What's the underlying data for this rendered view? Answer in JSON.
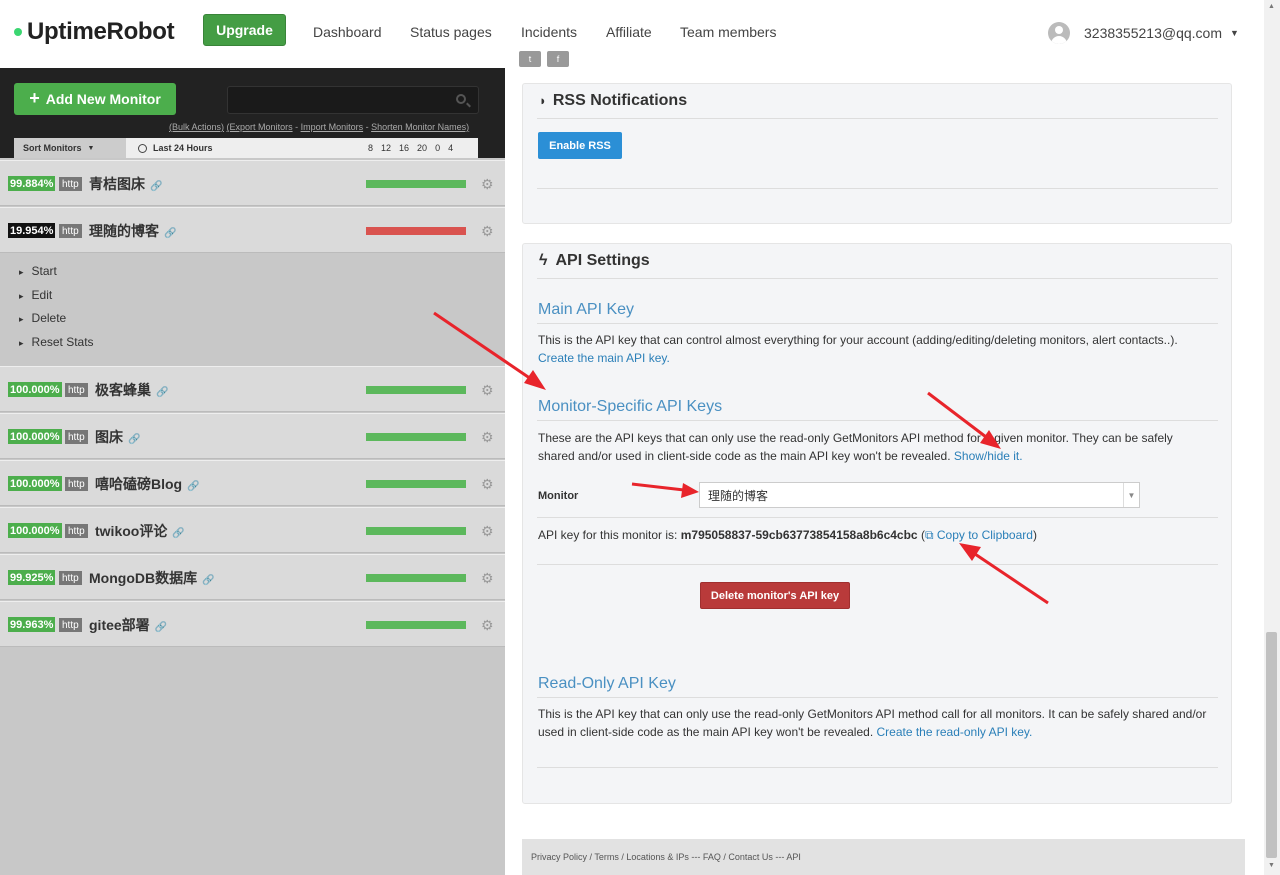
{
  "brand": {
    "name": "UptimeRobot"
  },
  "header": {
    "upgrade_label": "Upgrade",
    "nav": [
      "Dashboard",
      "Status pages",
      "Incidents",
      "Affiliate",
      "Team members"
    ],
    "user_email": "3238355213@qq.com"
  },
  "sidebar": {
    "add_monitor_label": "Add New Monitor",
    "search_placeholder": "",
    "bulk_links": [
      "(Bulk Actions)",
      "(Export Monitors",
      "Import Monitors",
      "Shorten Monitor Names)"
    ],
    "sort_label": "Sort Monitors",
    "range_label": "Last 24 Hours",
    "hours": [
      "8",
      "12",
      "16",
      "20",
      "0",
      "4"
    ],
    "monitors": [
      {
        "uptime": "99.884%",
        "type": "http",
        "name": "青桔图床",
        "status": "up"
      },
      {
        "uptime": "19.954%",
        "type": "http",
        "name": "理随的博客",
        "status": "down"
      },
      {
        "uptime": "100.000%",
        "type": "http",
        "name": "极客蜂巢",
        "status": "up"
      },
      {
        "uptime": "100.000%",
        "type": "http",
        "name": "图床",
        "status": "up"
      },
      {
        "uptime": "100.000%",
        "type": "http",
        "name": "嘻哈磕磅Blog",
        "status": "up"
      },
      {
        "uptime": "100.000%",
        "type": "http",
        "name": "twikoo评论",
        "status": "up"
      },
      {
        "uptime": "99.925%",
        "type": "http",
        "name": "MongoDB数据库",
        "status": "up"
      },
      {
        "uptime": "99.963%",
        "type": "http",
        "name": "gitee部署",
        "status": "up"
      }
    ],
    "actions": [
      "Start",
      "Edit",
      "Delete",
      "Reset Stats"
    ]
  },
  "rss": {
    "title": "RSS Notifications",
    "enable_label": "Enable RSS"
  },
  "api": {
    "title": "API Settings",
    "main_heading": "Main API Key",
    "main_text": "This is the API key that can control almost everything for your account (adding/editing/deleting monitors, alert contacts..).",
    "main_link": "Create the main API key.",
    "monitor_heading": "Monitor-Specific API Keys",
    "monitor_text": "These are the API keys that can only use the read-only GetMonitors API method for a given monitor. They can be safely shared and/or used in client-side code as the main API key won't be revealed.",
    "monitor_link": "Show/hide it.",
    "monitor_label": "Monitor",
    "monitor_selected": "理随的博客",
    "key_label": "API key for this monitor is:",
    "key_value": "m795058837-59cb63773854158a8b6c4cbc",
    "copy_label": "Copy to Clipboard",
    "delete_label": "Delete monitor's API key",
    "readonly_heading": "Read-Only API Key",
    "readonly_text": "This is the API key that can only use the read-only GetMonitors API method call for all monitors. It can be safely shared and/or used in client-side code as the main API key won't be revealed.",
    "readonly_link": "Create the read-only API key."
  },
  "footer": {
    "text": "Privacy Policy / Terms / Locations & IPs --- FAQ / Contact Us --- API"
  },
  "colors": {
    "up": "#5cb85c",
    "down": "#d9534f",
    "accent": "#2b8fd6",
    "annotation": "#e8242b"
  }
}
